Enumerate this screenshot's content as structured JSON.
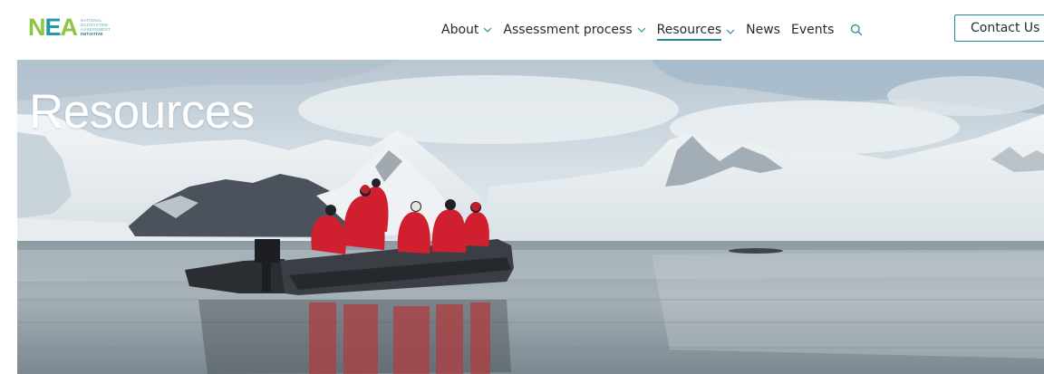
{
  "logo": {
    "mark_n": "N",
    "mark_e": "E",
    "mark_a": "A",
    "sub_lines": [
      "NATIONAL",
      "ECOSYSTEM",
      "ASSESSMENT",
      "INITIATIVE"
    ],
    "colors": {
      "green": "#8dc63f",
      "teal": "#1f9aa8"
    }
  },
  "nav": {
    "items": [
      {
        "label": "About",
        "has_dropdown": true
      },
      {
        "label": "Assessment process",
        "has_dropdown": true
      },
      {
        "label": "Resources",
        "has_dropdown": true,
        "active": true
      },
      {
        "label": "News",
        "has_dropdown": false
      },
      {
        "label": "Events",
        "has_dropdown": false
      }
    ],
    "search_icon": "search-icon",
    "contact_label": "Contact Us"
  },
  "hero": {
    "title": "Resources"
  },
  "theme": {
    "accent": "#1f8a9a",
    "text": "#1d2b33"
  }
}
